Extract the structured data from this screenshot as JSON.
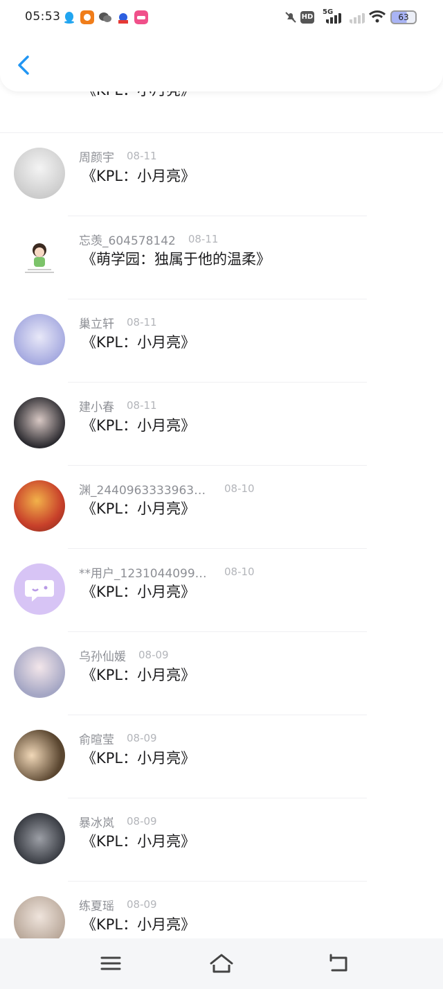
{
  "status_bar": {
    "time": "05:53",
    "network": "5G",
    "hd": "HD",
    "battery": "63",
    "icons": [
      "qq-icon",
      "app-icon",
      "wechat-icon",
      "baidu-icon",
      "soul-icon",
      "mute-icon",
      "hd-icon",
      "signal-icon",
      "wifi-icon",
      "battery-icon"
    ]
  },
  "header": {
    "back_icon": "chevron-left-icon"
  },
  "rows": [
    {
      "username": "",
      "date": "",
      "title": "《KPL：小月亮》"
    },
    {
      "username": "周颜宇",
      "date": "08-11",
      "title": "《KPL：小月亮》"
    },
    {
      "username": "忘羡_604578142",
      "date": "08-11",
      "title": "《萌学园：独属于他的温柔》"
    },
    {
      "username": "巢立轩",
      "date": "08-11",
      "title": "《KPL：小月亮》"
    },
    {
      "username": "建小春",
      "date": "08-11",
      "title": "《KPL：小月亮》"
    },
    {
      "username": "渊_244096333396355…",
      "date": "08-10",
      "title": "《KPL：小月亮》"
    },
    {
      "username": "**用户_123104409975…",
      "date": "08-10",
      "title": "《KPL：小月亮》"
    },
    {
      "username": "乌孙仙媛",
      "date": "08-09",
      "title": "《KPL：小月亮》"
    },
    {
      "username": "俞暄莹",
      "date": "08-09",
      "title": "《KPL：小月亮》"
    },
    {
      "username": "暴冰岚",
      "date": "08-09",
      "title": "《KPL：小月亮》"
    },
    {
      "username": "练夏瑶",
      "date": "08-09",
      "title": "《KPL：小月亮》"
    }
  ],
  "nav_bar": {
    "icons": [
      "menu-icon",
      "home-icon",
      "back-icon"
    ]
  },
  "colors": {
    "accent": "#2196f3",
    "username": "#8d8f95",
    "date": "#b3b5ba",
    "title": "#1c1c1e"
  }
}
